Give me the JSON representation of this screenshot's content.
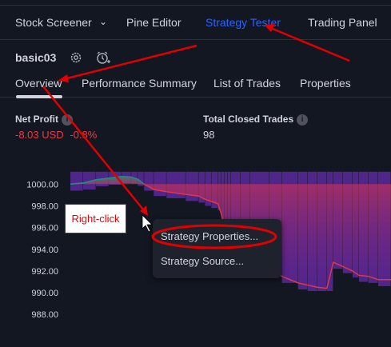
{
  "topbar": {
    "tabs": [
      {
        "label": "Stock Screener"
      },
      {
        "label": "Pine Editor"
      },
      {
        "label": "Strategy Tester"
      },
      {
        "label": "Trading Panel"
      }
    ],
    "dropdown_icon": "chevron-down-icon"
  },
  "strategy": {
    "name": "basic03",
    "settings_icon": "gear-icon",
    "alert_icon": "add-alarm-icon"
  },
  "subtabs": [
    {
      "label": "Overview"
    },
    {
      "label": "Performance Summary"
    },
    {
      "label": "List of Trades"
    },
    {
      "label": "Properties"
    }
  ],
  "metrics": {
    "net_profit": {
      "label": "Net Profit",
      "value": "-8.03 USD",
      "percent": "-0.8%"
    },
    "total_closed_trades": {
      "label": "Total Closed Trades",
      "value": "98"
    }
  },
  "chart_data": {
    "type": "area",
    "ytick_labels": [
      "1000.00",
      "998.00",
      "996.00",
      "994.00",
      "992.00",
      "990.00",
      "988.00"
    ],
    "ylim": [
      987.5,
      1001.2
    ],
    "equity": [
      [
        0,
        1000.0
      ],
      [
        4,
        1000.1
      ],
      [
        8,
        1000.4
      ],
      [
        12,
        1000.55
      ],
      [
        16,
        1000.7
      ],
      [
        19,
        1000.65
      ],
      [
        21,
        1000.45
      ],
      [
        23,
        1000.0
      ],
      [
        26,
        999.5
      ],
      [
        30,
        999.3
      ],
      [
        36,
        999.05
      ],
      [
        40,
        998.9
      ],
      [
        42,
        998.6
      ],
      [
        44,
        998.4
      ],
      [
        46,
        998.2
      ],
      [
        47,
        997.3
      ],
      [
        48,
        996.4
      ],
      [
        49,
        995.4
      ],
      [
        50,
        994.2
      ],
      [
        53,
        993.6
      ],
      [
        56,
        993.1
      ],
      [
        62,
        992.4
      ],
      [
        66,
        991.5
      ],
      [
        71,
        990.9
      ],
      [
        74,
        990.7
      ],
      [
        77,
        990.5
      ],
      [
        80,
        990.4
      ],
      [
        82,
        992.8
      ],
      [
        85,
        992.4
      ],
      [
        88,
        992.0
      ],
      [
        90,
        991.6
      ],
      [
        93,
        991.5
      ],
      [
        96,
        991.2
      ],
      [
        100,
        991.2
      ]
    ],
    "drawdown_color": "#5b2a9e",
    "profit_color": "#089981",
    "loss_color": "#f23645"
  },
  "annotation": {
    "callout_label": "Right-click"
  },
  "context_menu": {
    "items": [
      {
        "label": "Strategy Properties..."
      },
      {
        "label": "Strategy Source..."
      }
    ]
  },
  "colors": {
    "accent": "#2962ff",
    "annotation_red": "#e00000"
  }
}
